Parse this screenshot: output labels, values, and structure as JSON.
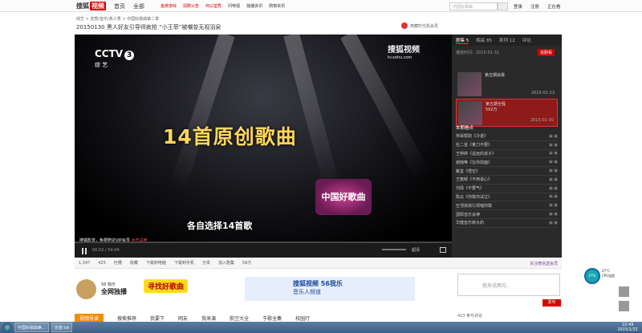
{
  "topbar": {
    "logo_text": "搜狐",
    "logo_badge": "视频",
    "nav": [
      "首页",
      "全部"
    ],
    "promos": [
      "金牌游戏",
      "招聘公告",
      "何以鉴秀",
      "问电视",
      "独播资讯",
      "购物资讯"
    ],
    "search_placeholder": "中国好歌曲",
    "user_links": [
      "登录",
      "注册",
      "正在看"
    ]
  },
  "breadcrumb": "综艺 > 选秀/音乐/真人秀 > 中国好歌曲第二季",
  "video_title": "20150130 黑人好友引导师疯抢 “小王菲”被嘲曾无视羽泉",
  "sponsor_text": "典藏时光机会员",
  "player": {
    "channel": "CCTV",
    "channel_num": "3",
    "channel_sub": "综 艺",
    "watermark": "搜狐视频",
    "watermark_url": "tv.sohu.com",
    "caption": "14首原创歌曲",
    "subtitle": "各自选择14首歌",
    "show_logo": "中国好歌曲",
    "vip_text": "搜狐影音，免费陪这VIP会员",
    "vip_link": "点击试用",
    "time_current": "00:02",
    "time_total": "54:04",
    "quality": "超清"
  },
  "below_player": [
    "1,347",
    "425",
    "吐槽",
    "",
    "收藏",
    "下载到电脑",
    "下载到手机",
    "分享",
    "",
    "加入剧集",
    "59万"
  ],
  "sidebar": {
    "tabs": [
      {
        "label": "剧集",
        "count": "5"
      },
      {
        "label": "相关",
        "count": "85"
      },
      {
        "label": "系列",
        "count": "12"
      },
      {
        "label": "评论",
        "count": ""
      }
    ],
    "date_header": "播放时间：2015-01-31",
    "subscribe_label": "追剧看",
    "episodes": [
      {
        "title": "第五期会歌",
        "date": "2015-01-23"
      },
      {
        "title": "第五期全程",
        "date": "2015-01-30",
        "views": "592万"
      }
    ],
    "section_header": "本期看点",
    "topics": [
      "帅哥帮助《冷诺》",
      "杜二苗《某刀不要》",
      "王婷婷《遥远的孩子》",
      "谢雨唯《在你前面》",
      "戴荃《悟空》",
      "王筱郁《不用说心》",
      "刘倩《不要气》",
      "陈云《你敢你试过》",
      "空顶渐渐引领唱你敢",
      "邵阳音乐会神",
      "华健音乐转大的"
    ],
    "vip_text": "关注微信送会员"
  },
  "ads": {
    "left_title": "全网独播",
    "left_brand": "56 我乐",
    "left_mid": "寻找好歌曲",
    "right_brand": "搜狐视频 56我乐",
    "right_channel": "音乐人频道"
  },
  "navrow": [
    "视频导读",
    "搜索推荐",
    "我要下",
    "网友",
    "我来演",
    "航空大全",
    "于歌全集",
    "校园行"
  ],
  "comment": {
    "placeholder": "我来说两句..",
    "count": "423",
    "count_label": "参与评论",
    "publish": "发布"
  },
  "cpu": {
    "label": "27%",
    "temp": "27°C",
    "temp_label": "CPU温度"
  },
  "taskbar": {
    "items": [
      "中国好歌曲第...",
      "失望.txt"
    ],
    "time": "22:49",
    "date": "2015/1/31"
  }
}
